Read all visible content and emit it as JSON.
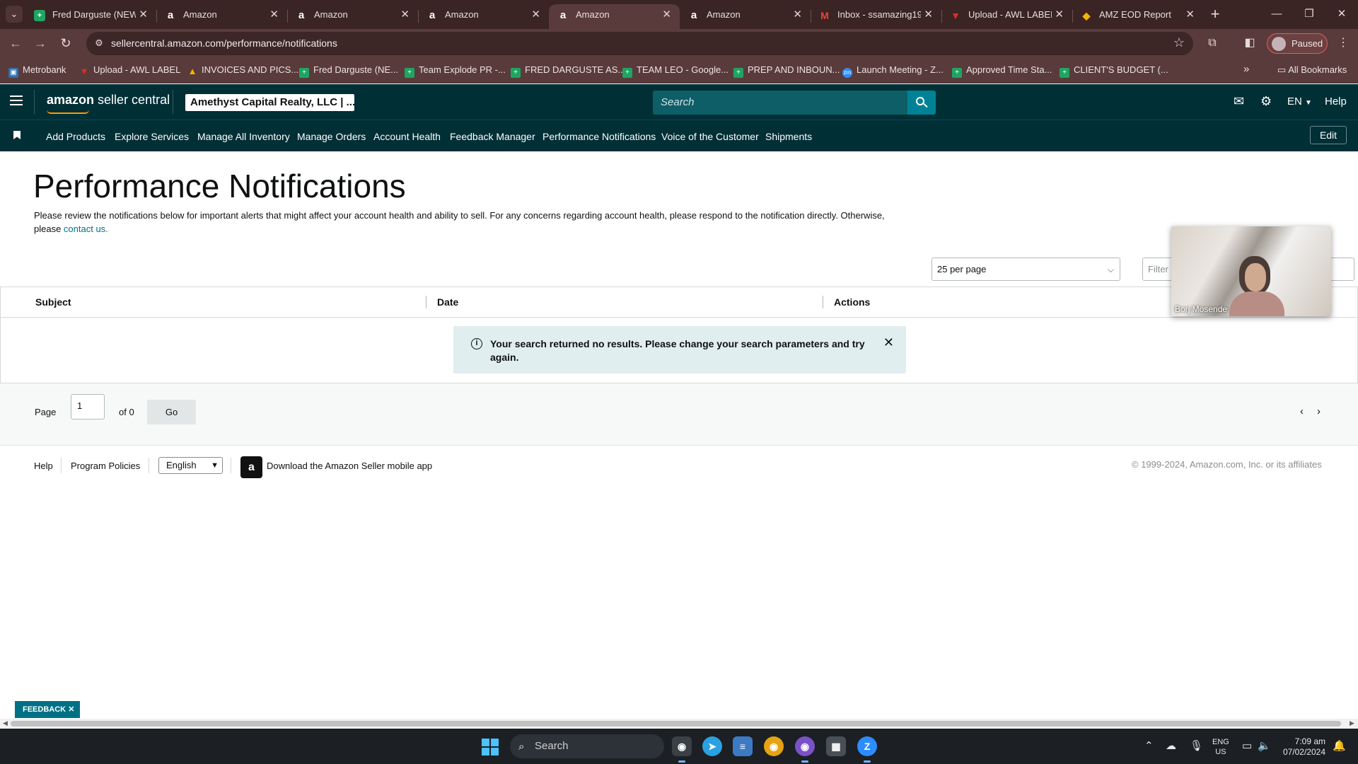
{
  "browser": {
    "tabs": [
      {
        "title": "Fred Darguste (NEW",
        "icon": "sheets-icon",
        "active": false
      },
      {
        "title": "Amazon",
        "icon": "amazon-icon",
        "active": false
      },
      {
        "title": "Amazon",
        "icon": "amazon-icon",
        "active": false
      },
      {
        "title": "Amazon",
        "icon": "amazon-icon",
        "active": false
      },
      {
        "title": "Amazon",
        "icon": "amazon-icon",
        "active": true
      },
      {
        "title": "Amazon",
        "icon": "amazon-icon",
        "active": false
      },
      {
        "title": "Inbox - ssamazing19",
        "icon": "gmail-icon",
        "active": false
      },
      {
        "title": "Upload - AWL LABEL",
        "icon": "label-icon",
        "active": false
      },
      {
        "title": "AMZ EOD Report",
        "icon": "report-icon",
        "active": false
      }
    ],
    "url": "sellercentral.amazon.com/performance/notifications",
    "profile_status": "Paused",
    "bookmarks": [
      {
        "label": "Metrobank",
        "icon": "bank-icon"
      },
      {
        "label": "Upload - AWL LABEL",
        "icon": "label-icon"
      },
      {
        "label": "INVOICES AND PICS...",
        "icon": "drive-icon"
      },
      {
        "label": "Fred Darguste (NE...",
        "icon": "sheets-icon"
      },
      {
        "label": "Team Explode PR -...",
        "icon": "sheets-icon"
      },
      {
        "label": "FRED DARGUSTE AS...",
        "icon": "sheets-icon"
      },
      {
        "label": "TEAM LEO - Google...",
        "icon": "sheets-icon"
      },
      {
        "label": "PREP AND INBOUN...",
        "icon": "sheets-icon"
      },
      {
        "label": "Launch Meeting - Z...",
        "icon": "zoom-icon"
      },
      {
        "label": "Approved Time Sta...",
        "icon": "sheets-icon"
      },
      {
        "label": "CLIENT'S BUDGET (...",
        "icon": "sheets-icon"
      }
    ],
    "all_bookmarks": "All Bookmarks"
  },
  "header": {
    "logo_brand": "amazon",
    "logo_product": "seller central",
    "account": "Amethyst Capital Realty, LLC | ...",
    "search_placeholder": "Search",
    "language": "EN",
    "help": "Help"
  },
  "nav": {
    "items": [
      "Add Products",
      "Explore Services",
      "Manage All Inventory",
      "Manage Orders",
      "Account Health",
      "Feedback Manager",
      "Performance Notifications",
      "Voice of the Customer",
      "Shipments"
    ],
    "edit": "Edit"
  },
  "page": {
    "title": "Performance Notifications",
    "intro": "Please review the notifications below for important alerts that might affect your account health and ability to sell. For any concerns regarding account health, please respond to the notification directly. Otherwise, please ",
    "contact_link": "contact us.",
    "per_page": "25 per page",
    "filter_placeholder": "Filter b",
    "columns": [
      "Subject",
      "Date",
      "Actions"
    ],
    "no_results": "Your search returned no results. Please change your search parameters and try again."
  },
  "pager": {
    "label": "Page",
    "current": "1",
    "of": "of 0",
    "go": "Go"
  },
  "footer": {
    "help": "Help",
    "policies": "Program Policies",
    "language": "English",
    "app_promo": "Download the Amazon Seller mobile app",
    "copyright": "© 1999-2024, Amazon.com, Inc. or its affiliates"
  },
  "video": {
    "participant": "Borj Mosende"
  },
  "feedback": "FEEDBACK",
  "taskbar": {
    "search": "Search",
    "lang_top": "ENG",
    "lang_bottom": "US",
    "time": "7:09 am",
    "date": "07/02/2024"
  }
}
